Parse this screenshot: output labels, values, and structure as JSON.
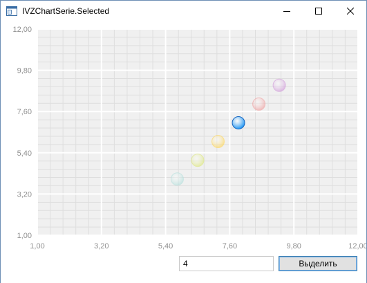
{
  "window": {
    "title": "IVZChartSerie.Selected",
    "icon": "window-app-icon",
    "controls": [
      "minimize-icon",
      "maximize-icon",
      "close-icon"
    ]
  },
  "controls": {
    "input_value": "4",
    "select_button_label": "Выделить"
  },
  "chart_data": {
    "type": "scatter",
    "title": "",
    "xlabel": "",
    "ylabel": "",
    "xlim": [
      1.0,
      12.0
    ],
    "ylim": [
      1.0,
      12.0
    ],
    "x_ticks": [
      "1,00",
      "3,20",
      "5,40",
      "7,60",
      "9,80",
      "12,00"
    ],
    "y_ticks": [
      "1,00",
      "3,20",
      "5,40",
      "7,60",
      "9,80",
      "12,00"
    ],
    "grid": true,
    "legend": "none",
    "points": [
      {
        "x": 5.8,
        "y": 4.0,
        "color": "#b2dfdb",
        "selected": false
      },
      {
        "x": 6.5,
        "y": 5.0,
        "color": "#dce775",
        "selected": false
      },
      {
        "x": 7.2,
        "y": 6.0,
        "color": "#ffd54f",
        "selected": false
      },
      {
        "x": 7.9,
        "y": 7.0,
        "color": "#2196f3",
        "selected": true
      },
      {
        "x": 8.6,
        "y": 8.0,
        "color": "#ef9a9a",
        "selected": false
      },
      {
        "x": 9.3,
        "y": 9.0,
        "color": "#ce93d8",
        "selected": false
      }
    ]
  }
}
